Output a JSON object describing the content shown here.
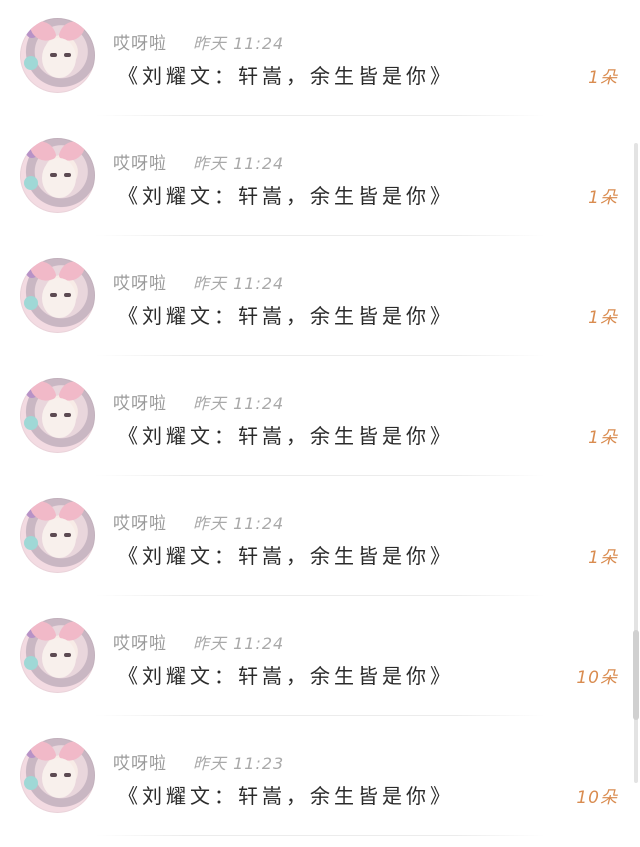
{
  "items": [
    {
      "username": "哎呀啦",
      "time": "昨天 11:24",
      "message": "《刘耀文：轩嵩，余生皆是你》",
      "count": "1朵"
    },
    {
      "username": "哎呀啦",
      "time": "昨天 11:24",
      "message": "《刘耀文：轩嵩，余生皆是你》",
      "count": "1朵"
    },
    {
      "username": "哎呀啦",
      "time": "昨天 11:24",
      "message": "《刘耀文：轩嵩，余生皆是你》",
      "count": "1朵"
    },
    {
      "username": "哎呀啦",
      "time": "昨天 11:24",
      "message": "《刘耀文：轩嵩，余生皆是你》",
      "count": "1朵"
    },
    {
      "username": "哎呀啦",
      "time": "昨天 11:24",
      "message": "《刘耀文：轩嵩，余生皆是你》",
      "count": "1朵"
    },
    {
      "username": "哎呀啦",
      "time": "昨天 11:24",
      "message": "《刘耀文：轩嵩，余生皆是你》",
      "count": "10朵"
    },
    {
      "username": "哎呀啦",
      "time": "昨天 11:23",
      "message": "《刘耀文：轩嵩，余生皆是你》",
      "count": "10朵"
    }
  ],
  "colors": {
    "username": "#9a9a9a",
    "time": "#a9a9a9",
    "message": "#2b2b2b",
    "count": "#d98c50"
  },
  "icons": {
    "avatar": "user-avatar-photo"
  }
}
